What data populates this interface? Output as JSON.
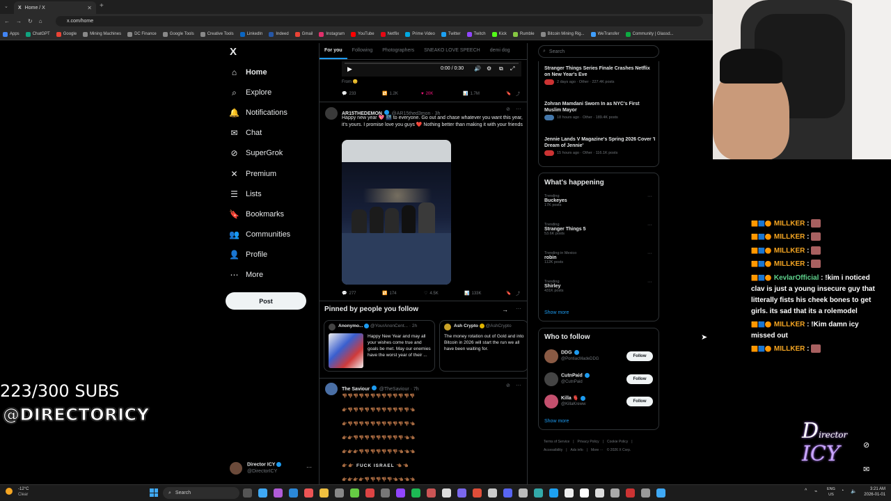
{
  "browser": {
    "tab_title": "Home / X",
    "url": "x.com/home",
    "bookmarks": [
      "Apps",
      "ChatGPT",
      "Google",
      "Mining Machines",
      "DC Finance",
      "Google Tools",
      "Creative Tools",
      "LinkedIn",
      "Indeed",
      "Gmail",
      "Instagram",
      "YouTube",
      "Netflix",
      "Prime Video",
      "Twitter",
      "Twitch",
      "Kick",
      "Rumble",
      "Bitcoin Mining Rig...",
      "WeTransfer",
      "Community | Glassd..."
    ]
  },
  "nav": {
    "logo": "X",
    "items": [
      {
        "label": "Home",
        "icon": "home-icon"
      },
      {
        "label": "Explore",
        "icon": "search-icon"
      },
      {
        "label": "Notifications",
        "icon": "bell-icon"
      },
      {
        "label": "Chat",
        "icon": "chat-icon"
      },
      {
        "label": "SuperGrok",
        "icon": "grok-icon"
      },
      {
        "label": "Premium",
        "icon": "x-icon"
      },
      {
        "label": "Lists",
        "icon": "list-icon"
      },
      {
        "label": "Bookmarks",
        "icon": "bookmark-icon"
      },
      {
        "label": "Communities",
        "icon": "people-icon"
      },
      {
        "label": "Profile",
        "icon": "person-icon"
      },
      {
        "label": "More",
        "icon": "more-icon"
      }
    ],
    "post_label": "Post",
    "account_name": "Director ICY",
    "account_handle": "@DirectorICY"
  },
  "feed": {
    "tabs": [
      "For you",
      "Following",
      "Photographers",
      "SNEAKO LOVE SPEECH",
      "demi dog"
    ],
    "video": {
      "time": "0:00 / 0:30",
      "from_label": "From"
    },
    "tweet0_metrics": {
      "replies": "233",
      "reposts": "1.2K",
      "likes": "20K",
      "views": "1.7M"
    },
    "tweet1": {
      "name": "AR15THEDEMON",
      "handle": "@AR15thed3mon · 3h",
      "text": "Happy new year 💖 🌃 to everyone. Go out and chase whatever you want this year, it's yours. I promise love you guys ❤️ Nothing better than making it with your friends",
      "replies": "277",
      "reposts": "174",
      "likes": "4.5K",
      "views": "133K"
    },
    "pinned": {
      "title": "Pinned by people you follow",
      "card1_name": "Anonymo...",
      "card1_handle": "@YourAnonCent... · 2h",
      "card1_text": "Happy New Year and may all your wishes come true and goals be met. May our enemies have the worst year of their ...",
      "card2_name": "Ash Crypto",
      "card2_handle": "@AshCrypto",
      "card2_text": "The money rotation out of Gold and into Bitcoin in 2026 will start the run we all have been waiting for."
    },
    "tweet2": {
      "name": "The Saviour",
      "handle": "@TheSaviour · 7h",
      "emoji_rows": [
        "👎🏾👎🏾👎🏾👎🏾👎🏾👎🏾👎🏾👎🏾👎🏾👎🏾👎🏾👎🏾👎🏾",
        "👉🏾👎🏾👎🏾👎🏾👎🏾👎🏾👎🏾👎🏾👎🏾👎🏾👎🏾👎🏾👈🏾",
        "👉🏾👎🏾👎🏾👎🏾👎🏾👎🏾👎🏾👎🏾👎🏾👎🏾👎🏾👎🏾👈🏾",
        "👉🏾👉🏾👎🏾👎🏾👎🏾👎🏾👎🏾👎🏾👎🏾👎🏾👎🏾👈🏾👈🏾",
        "👉🏾👉🏾👉🏾👎🏾👎🏾👎🏾👎🏾👎🏾👎🏾👎🏾👈🏾👈🏾👈🏾",
        "👉🏾👉🏾 FUCK ISRAEL 👈🏾👈🏾",
        "👉🏾👉🏾👉🏾👉🏾👎🏾👎🏾👎🏾👎🏾👎🏾👈🏾👈🏾👈🏾👈🏾"
      ]
    }
  },
  "right": {
    "search_placeholder": "Search",
    "news": [
      {
        "title": "Stranger Things Series Finale Crashes Netflix on New Year's Eve",
        "meta": "2 days ago · Other · 227.4K posts"
      },
      {
        "title": "Zohran Mamdani Sworn In as NYC's First Muslim Mayor",
        "meta": "18 hours ago · Other · 189.4K posts"
      },
      {
        "title": "Jennie Lands V Magazine's Spring 2026 Cover 'I Dream of Jennie'",
        "meta": "15 hours ago · Other · 116.1K posts"
      }
    ],
    "happening_title": "What's happening",
    "trends": [
      {
        "context": "Trending",
        "name": "Buckeyes",
        "count": "17K posts"
      },
      {
        "context": "Trending",
        "name": "Stranger Things 5",
        "count": "53.6K posts"
      },
      {
        "context": "Trending in Mexico",
        "name": "robin",
        "count": "112K posts"
      },
      {
        "context": "Trending",
        "name": "Shirley",
        "count": "431K posts"
      }
    ],
    "show_more": "Show more",
    "wtf_title": "Who to follow",
    "follows": [
      {
        "name": "DDG",
        "handle": "@PontiacMadeDDG"
      },
      {
        "name": "CutnPaid",
        "handle": "@CutnPaid"
      },
      {
        "name": "Killa 🫀",
        "handle": "@KillaKreww"
      }
    ],
    "follow_label": "Follow",
    "footer_row1": [
      "Terms of Service",
      "|",
      "Privacy Policy",
      "|",
      "Cookie Policy",
      "|"
    ],
    "footer_row2": [
      "Accessibility",
      "|",
      "Ads info",
      "|",
      "More ···",
      "© 2026 X Corp."
    ]
  },
  "stream": {
    "subs": "223/300 SUBS",
    "handle": "@DIRECTORICY",
    "chat": [
      {
        "user": "MILLKER",
        "msg": ""
      },
      {
        "user": "MILLKER",
        "msg": ""
      },
      {
        "user": "MILLKER",
        "msg": ""
      },
      {
        "user": "MILLKER",
        "msg": ""
      },
      {
        "user": "KevlarOfficial",
        "msg": "!kim i noticed clav is just a young insecure guy that litterally fists his cheek bones to get girls. its sad that its a rolemodel"
      },
      {
        "user": "MILLKER",
        "msg": "!Kim damn icy missed out"
      },
      {
        "user": "MILLKER",
        "msg": ""
      }
    ]
  },
  "taskbar": {
    "weather_temp": "-12°C",
    "weather_desc": "Clear",
    "search_label": "Search",
    "lang": "ENG",
    "region": "US",
    "time": "3:21 AM",
    "date": "2026-01-01"
  }
}
